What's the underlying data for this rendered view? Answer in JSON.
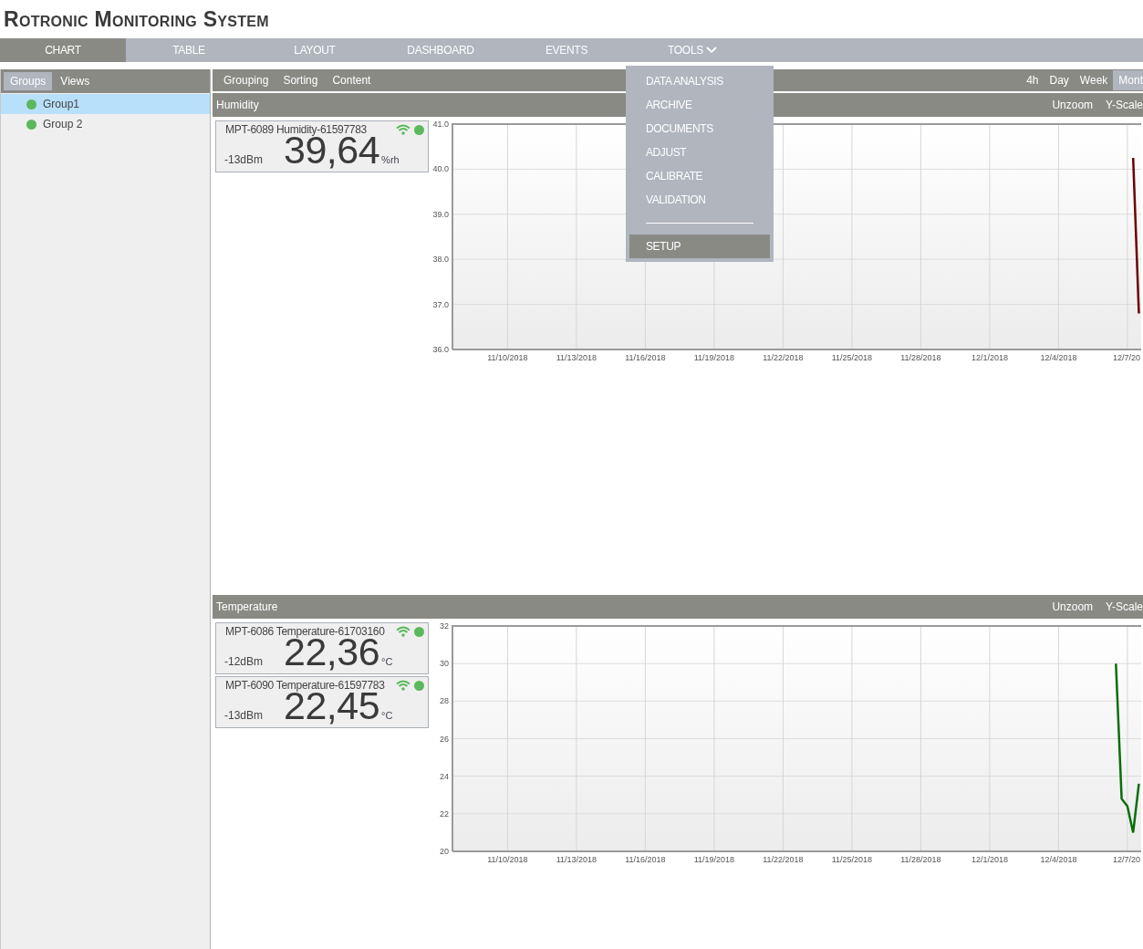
{
  "app_title": "Rotronic Monitoring System",
  "nav_tabs": [
    {
      "label": "CHART",
      "selected": true
    },
    {
      "label": "TABLE",
      "selected": false
    },
    {
      "label": "LAYOUT",
      "selected": false
    },
    {
      "label": "DASHBOARD",
      "selected": false
    },
    {
      "label": "EVENTS",
      "selected": false
    },
    {
      "label": "TOOLS",
      "selected": false
    }
  ],
  "tools_menu": {
    "items": [
      {
        "label": "DATA ANALYSIS",
        "selected": false
      },
      {
        "label": "ARCHIVE",
        "selected": false
      },
      {
        "label": "DOCUMENTS",
        "selected": false
      },
      {
        "label": "ADJUST",
        "selected": false
      },
      {
        "label": "CALIBRATE",
        "selected": false
      },
      {
        "label": "VALIDATION",
        "selected": false
      },
      {
        "label": "SETUP",
        "selected": true
      }
    ]
  },
  "sidebar": {
    "tabs": [
      {
        "label": "Groups",
        "selected": true
      },
      {
        "label": "Views",
        "selected": false
      }
    ],
    "groups": [
      {
        "label": "Group1",
        "selected": true
      },
      {
        "label": "Group 2",
        "selected": false
      }
    ]
  },
  "toolbar": {
    "items": [
      "Grouping",
      "Sorting",
      "Content"
    ],
    "ranges": [
      {
        "label": "4h",
        "selected": false
      },
      {
        "label": "Day",
        "selected": false
      },
      {
        "label": "Week",
        "selected": false
      },
      {
        "label": "Mont",
        "selected": true
      }
    ]
  },
  "panels": [
    {
      "title": "Humidity",
      "actions": [
        "Unzoom",
        "Y-Scale"
      ],
      "sensors": [
        {
          "name": "MPT-6089 Humidity-61597783",
          "signal": "-13dBm",
          "value": "39,64",
          "unit": "%rh"
        }
      ],
      "chart_data": {
        "type": "line",
        "categories": [
          null,
          null,
          null,
          null,
          null,
          null,
          null,
          null,
          null,
          "11/10/2018",
          null,
          null,
          null,
          null,
          null,
          null,
          null,
          null,
          null,
          null,
          null,
          "11/13/2018",
          null,
          null,
          null,
          null,
          null,
          null,
          null,
          null,
          null,
          null,
          null,
          "11/16/2018",
          null,
          null,
          null,
          null,
          null,
          null,
          null,
          null,
          null,
          null,
          null,
          "11/19/2018",
          null,
          null,
          null,
          null,
          null,
          null,
          null,
          null,
          null,
          null,
          null,
          "11/22/2018",
          null,
          null,
          null,
          null,
          null,
          null,
          null,
          null,
          null,
          null,
          null,
          "11/25/2018",
          null,
          null,
          null,
          null,
          null,
          null,
          null,
          null,
          null,
          null,
          null,
          "11/28/2018",
          null,
          null,
          null,
          null,
          null,
          null,
          null,
          null,
          null,
          null,
          null,
          "12/1/2018",
          null,
          null,
          null,
          null,
          null,
          null,
          null,
          null,
          null,
          null,
          null,
          "12/4/2018",
          null,
          null,
          null,
          null,
          null,
          null,
          null,
          null,
          null,
          null,
          null,
          "12/7/20",
          null,
          null
        ],
        "series": [
          {
            "color": "#6b0000",
            "values": [
              null,
              null,
              null,
              null,
              null,
              null,
              null,
              null,
              null,
              null,
              null,
              null,
              null,
              null,
              null,
              null,
              null,
              null,
              null,
              null,
              null,
              null,
              null,
              null,
              null,
              null,
              null,
              null,
              null,
              null,
              null,
              null,
              null,
              null,
              null,
              null,
              null,
              null,
              null,
              null,
              null,
              null,
              null,
              null,
              null,
              null,
              null,
              null,
              null,
              null,
              null,
              null,
              null,
              null,
              null,
              null,
              null,
              null,
              null,
              null,
              null,
              null,
              null,
              null,
              null,
              null,
              null,
              null,
              null,
              null,
              null,
              null,
              null,
              null,
              null,
              null,
              null,
              null,
              null,
              null,
              null,
              null,
              null,
              null,
              null,
              null,
              null,
              null,
              null,
              null,
              null,
              null,
              null,
              null,
              null,
              null,
              null,
              null,
              null,
              null,
              null,
              null,
              null,
              null,
              null,
              null,
              null,
              null,
              null,
              null,
              null,
              null,
              null,
              null,
              null,
              null,
              null,
              null,
              40.25,
              36.8
            ]
          }
        ],
        "grid": true,
        "ylim": [
          36,
          41
        ],
        "yticks": [
          {
            "value": 36,
            "label": "36.0"
          },
          {
            "value": 37,
            "label": "37.0"
          },
          {
            "value": 38,
            "label": "38.0"
          },
          {
            "value": 39,
            "label": "39.0"
          },
          {
            "value": 40,
            "label": "40.0"
          },
          {
            "value": 41,
            "label": "41.0"
          }
        ]
      }
    },
    {
      "title": "Temperature",
      "actions": [
        "Unzoom",
        "Y-Scale"
      ],
      "sensors": [
        {
          "name": "MPT-6086 Temperature-61703160",
          "signal": "-12dBm",
          "value": "22,36",
          "unit": "°C"
        },
        {
          "name": "MPT-6090 Temperature-61597783",
          "signal": "-13dBm",
          "value": "22,45",
          "unit": "°C"
        }
      ],
      "chart_data": {
        "type": "line",
        "categories": [
          null,
          null,
          null,
          null,
          null,
          null,
          null,
          null,
          null,
          "11/10/2018",
          null,
          null,
          null,
          null,
          null,
          null,
          null,
          null,
          null,
          null,
          null,
          "11/13/2018",
          null,
          null,
          null,
          null,
          null,
          null,
          null,
          null,
          null,
          null,
          null,
          "11/16/2018",
          null,
          null,
          null,
          null,
          null,
          null,
          null,
          null,
          null,
          null,
          null,
          "11/19/2018",
          null,
          null,
          null,
          null,
          null,
          null,
          null,
          null,
          null,
          null,
          null,
          "11/22/2018",
          null,
          null,
          null,
          null,
          null,
          null,
          null,
          null,
          null,
          null,
          null,
          "11/25/2018",
          null,
          null,
          null,
          null,
          null,
          null,
          null,
          null,
          null,
          null,
          null,
          "11/28/2018",
          null,
          null,
          null,
          null,
          null,
          null,
          null,
          null,
          null,
          null,
          null,
          "12/1/2018",
          null,
          null,
          null,
          null,
          null,
          null,
          null,
          null,
          null,
          null,
          null,
          "12/4/2018",
          null,
          null,
          null,
          null,
          null,
          null,
          null,
          null,
          null,
          null,
          null,
          "12/7/20",
          null,
          null
        ],
        "series": [
          {
            "color": "#0a6e0a",
            "values": [
              null,
              null,
              null,
              null,
              null,
              null,
              null,
              null,
              null,
              null,
              null,
              null,
              null,
              null,
              null,
              null,
              null,
              null,
              null,
              null,
              null,
              null,
              null,
              null,
              null,
              null,
              null,
              null,
              null,
              null,
              null,
              null,
              null,
              null,
              null,
              null,
              null,
              null,
              null,
              null,
              null,
              null,
              null,
              null,
              null,
              null,
              null,
              null,
              null,
              null,
              null,
              null,
              null,
              null,
              null,
              null,
              null,
              null,
              null,
              null,
              null,
              null,
              null,
              null,
              null,
              null,
              null,
              null,
              null,
              null,
              null,
              null,
              null,
              null,
              null,
              null,
              null,
              null,
              null,
              null,
              null,
              null,
              null,
              null,
              null,
              null,
              null,
              null,
              null,
              null,
              null,
              null,
              null,
              null,
              null,
              null,
              null,
              null,
              null,
              null,
              null,
              null,
              null,
              null,
              null,
              null,
              null,
              null,
              null,
              null,
              null,
              null,
              null,
              null,
              null,
              30.0,
              22.8,
              22.4,
              21.0,
              23.6
            ]
          }
        ],
        "grid": true,
        "ylim": [
          20,
          32
        ],
        "yticks": [
          20,
          22,
          24,
          26,
          28,
          30,
          32
        ]
      }
    }
  ]
}
